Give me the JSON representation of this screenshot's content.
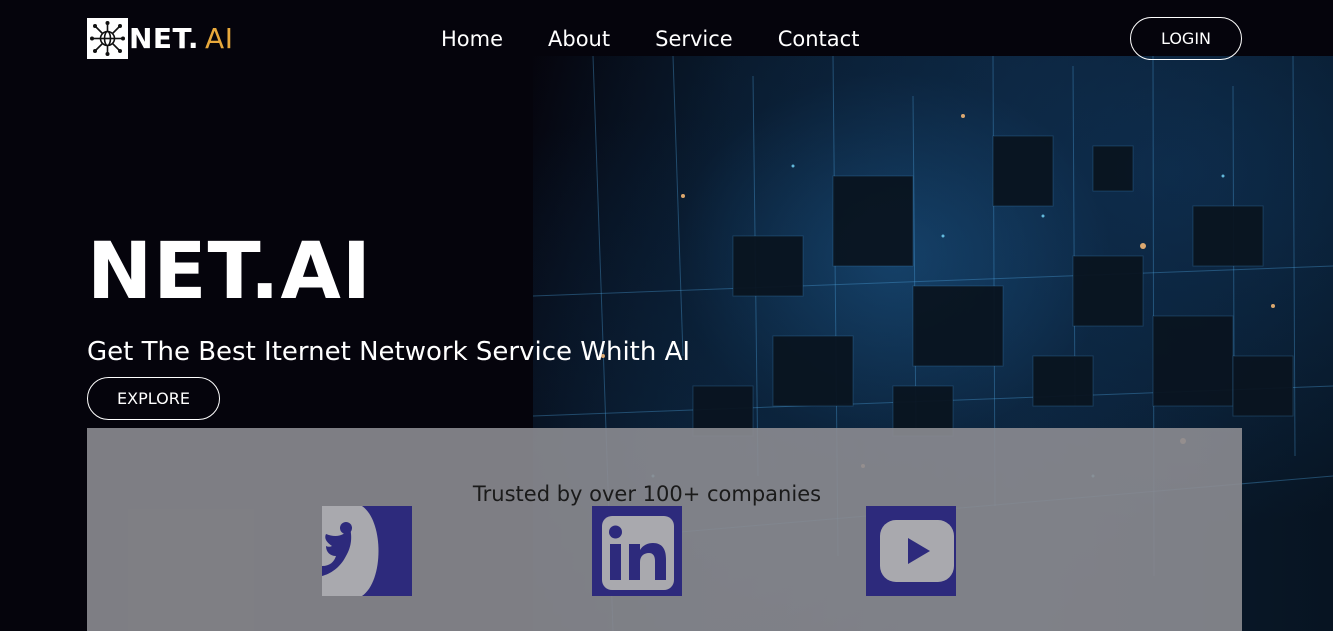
{
  "header": {
    "logo_name": "NET.",
    "logo_accent": "AI",
    "logo_icon": "globe-network-icon",
    "nav": [
      {
        "label": "Home"
      },
      {
        "label": "About"
      },
      {
        "label": "Service"
      },
      {
        "label": "Contact"
      }
    ],
    "login_label": "LOGIN"
  },
  "hero": {
    "title": "NET.AI",
    "subtitle": "Get The Best Iternet Network Service Whith AI",
    "explore_label": "EXPLORE"
  },
  "trusted": {
    "text": "Trusted by over 100+ companies",
    "brands": [
      {
        "icon": "twitter-icon"
      },
      {
        "icon": "linkedin-icon"
      },
      {
        "icon": "youtube-icon"
      }
    ]
  },
  "colors": {
    "background": "#05040c",
    "accent": "#e8a93c",
    "brand_tile": "#2d2a7c",
    "panel": "#8c8c91"
  }
}
